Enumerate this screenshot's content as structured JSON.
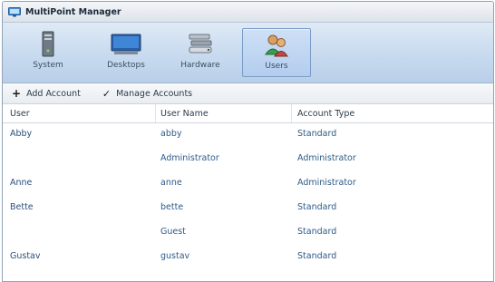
{
  "window": {
    "title": "MultiPoint Manager"
  },
  "ribbon": {
    "tabs": [
      {
        "label": "System",
        "icon": "server-icon"
      },
      {
        "label": "Desktops",
        "icon": "monitor-icon"
      },
      {
        "label": "Hardware",
        "icon": "hardware-icon"
      },
      {
        "label": "Users",
        "icon": "users-icon",
        "active": true
      }
    ]
  },
  "toolbar": {
    "add_account": "Add Account",
    "manage_accounts": "Manage Accounts"
  },
  "table": {
    "headers": [
      "User",
      "User Name",
      "Account Type"
    ],
    "rows": [
      {
        "user": "Abby",
        "user_name": "abby",
        "account_type": "Standard"
      },
      {
        "user": "",
        "user_name": "Administrator",
        "account_type": "Administrator"
      },
      {
        "user": "Anne",
        "user_name": "anne",
        "account_type": "Administrator"
      },
      {
        "user": "Bette",
        "user_name": "bette",
        "account_type": "Standard"
      },
      {
        "user": "",
        "user_name": "Guest",
        "account_type": "Standard"
      },
      {
        "user": "Gustav",
        "user_name": "gustav",
        "account_type": "Standard"
      }
    ]
  },
  "colors": {
    "accent": "#7a9cc8",
    "ribbon": "#c7daef",
    "link_text": "#2e5a8a"
  }
}
